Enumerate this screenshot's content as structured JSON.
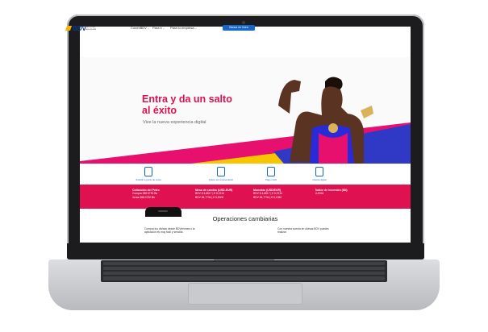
{
  "nav": {
    "logo_text": "BDV",
    "logo_sub": "Banco de Venezuela",
    "menu_items": [
      "ConexBDV",
      "Para ti",
      "Para tu empresa"
    ],
    "login_label": "Banca en línea"
  },
  "hero": {
    "title": "Entra y da un salto al éxito",
    "subtitle": "Vive la nueva experiencia digital"
  },
  "quicklinks": [
    {
      "label": "Solicitá tu punto de venta",
      "icon": "pos-icon"
    },
    {
      "label": "Quiero ser emprendedor",
      "icon": "person-icon"
    },
    {
      "label": "Pago móvil",
      "icon": "phone-icon"
    },
    {
      "label": "Cuenta digital",
      "icon": "card-icon"
    }
  ],
  "rates": [
    {
      "title": "Cotización del Petro",
      "lines": [
        "Compra 385.5730 Bs",
        "Venta 388.0730 Bs"
      ]
    },
    {
      "title": "Mesa de cambio (USD-EUR)",
      "lines": [
        "BDV $ 4,6517 | € 5,0744",
        "BDV 54,7734 | € 5,9006"
      ]
    },
    {
      "title": "Monedas (USD/EUR)",
      "lines": [
        "BDV $ 4,6517 | € 5,0744",
        "BDV 54,7734 | € 5,1352"
      ]
    },
    {
      "title": "Índice de inversión (IDI)",
      "lines": [
        "0,0016"
      ]
    }
  ],
  "ops": {
    "title": "Operaciones cambiarias",
    "left_text": "Compra tus divisas desde BDVenlínea o la aplicación es muy fácil y sencilla",
    "right_text": "Con nuestra cuenta en divisas BDV puedes realizar"
  },
  "colors": {
    "brand_blue": "#1467c7",
    "brand_red": "#e0104f",
    "stripe_yellow": "#f7c600",
    "stripe_magenta": "#e8106f",
    "stripe_blue": "#2f39c5"
  }
}
